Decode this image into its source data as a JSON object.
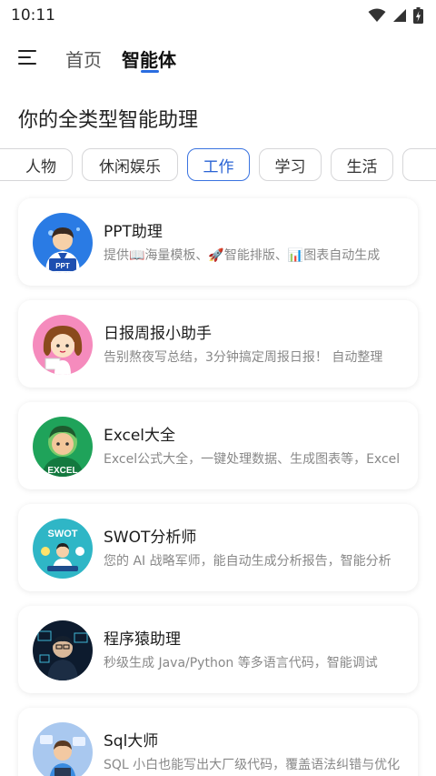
{
  "status": {
    "time": "10:11"
  },
  "header": {
    "tabs": [
      "首页",
      "智能体"
    ]
  },
  "headline": "你的全类型智能助理",
  "chips": [
    "人物",
    "休闲娱乐",
    "工作",
    "学习",
    "生活"
  ],
  "active_chip": "工作",
  "colors": {
    "accent": "#2a63d4",
    "text_primary": "#1c1c1c",
    "text_secondary": "#888888"
  },
  "agents": [
    {
      "title": "PPT助理",
      "desc": "提供📖海量模板、🚀智能排版、📊图表自动生成",
      "avatar_label": "PPT"
    },
    {
      "title": "日报周报小助手",
      "desc": "告别熬夜写总结，3分钟搞定周报日报！ 自动整理",
      "avatar_label": ""
    },
    {
      "title": "Excel大全",
      "desc": "Excel公式大全，一键处理数据、生成图表等，Excel",
      "avatar_label": "EXCEL"
    },
    {
      "title": "SWOT分析师",
      "desc": "您的 AI 战略军师，能自动生成分析报告，智能分析",
      "avatar_label": "SWOT"
    },
    {
      "title": "程序猿助理",
      "desc": "秒级生成 Java/Python 等多语言代码，智能调试",
      "avatar_label": ""
    },
    {
      "title": "Sql大师",
      "desc": "SQL 小白也能写出大厂级代码，覆盖语法纠错与优化",
      "avatar_label": ""
    }
  ]
}
